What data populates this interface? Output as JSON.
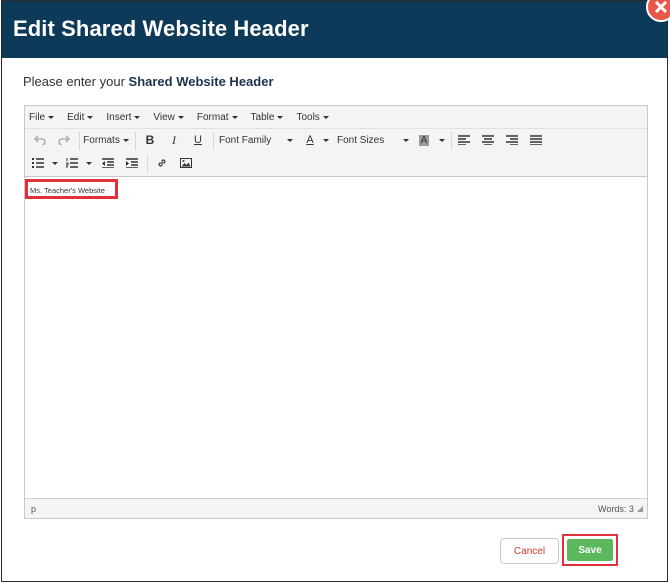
{
  "modal": {
    "title": "Edit Shared Website Header",
    "prompt_prefix": "Please enter your",
    "prompt_bold": "Shared Website Header"
  },
  "editor": {
    "menus": [
      "File",
      "Edit",
      "Insert",
      "View",
      "Format",
      "Table",
      "Tools"
    ],
    "toolbar": {
      "formats_label": "Formats",
      "bold_label": "B",
      "italic_label": "I",
      "underline_label": "U",
      "font_family_label": "Font Family",
      "font_color_label": "A",
      "font_sizes_label": "Font Sizes",
      "bg_color_label": "A"
    },
    "content_text": "Ms. Teacher's Website",
    "status_path": "p",
    "word_count": "Words: 3"
  },
  "buttons": {
    "cancel": "Cancel",
    "save": "Save"
  },
  "colors": {
    "header_bg": "#0e3a5a",
    "close_bg": "#e8584a",
    "save_bg": "#5cb85c",
    "cancel_text": "#d9372b",
    "highlight": "#e0313a"
  },
  "icons": {
    "close": "close-icon",
    "undo": "undo-icon",
    "redo": "redo-icon",
    "align_left": "align-left-icon",
    "align_center": "align-center-icon",
    "align_right": "align-right-icon",
    "align_justify": "align-justify-icon",
    "bullet_list": "bullet-list-icon",
    "numbered_list": "numbered-list-icon",
    "outdent": "outdent-icon",
    "indent": "indent-icon",
    "link": "link-icon",
    "image": "image-icon"
  }
}
